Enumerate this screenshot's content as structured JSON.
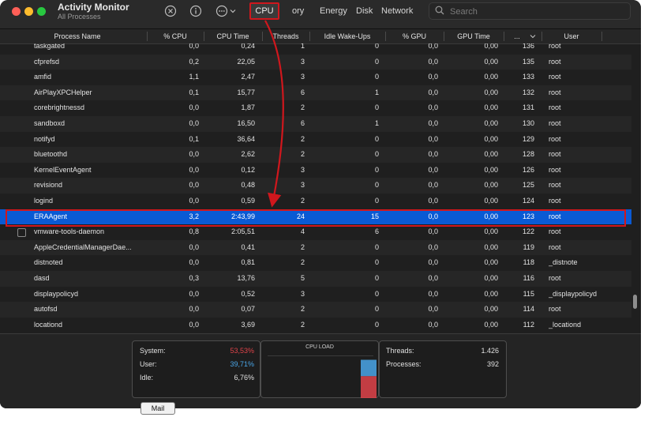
{
  "app": {
    "title": "Activity Monitor",
    "subtitle": "All Processes"
  },
  "toolbar": {
    "icons": [
      "stop-process-icon",
      "info-icon",
      "more-actions-icon",
      "chevron-down-icon"
    ],
    "tabs": [
      "CPU",
      "ory",
      "Energy",
      "Disk",
      "Network"
    ],
    "search_placeholder": "Search"
  },
  "columns": [
    "Process Name",
    "% CPU",
    "CPU Time",
    "Threads",
    "Idle Wake-Ups",
    "% GPU",
    "GPU Time",
    "...",
    "User"
  ],
  "rows": [
    {
      "name": "taskgated",
      "cpu": "0,0",
      "time": "0,24",
      "threads": "1",
      "wake": "0",
      "gpu": "0,0",
      "gtime": "0,00",
      "pid": "136",
      "user": "root"
    },
    {
      "name": "cfprefsd",
      "cpu": "0,2",
      "time": "22,05",
      "threads": "3",
      "wake": "0",
      "gpu": "0,0",
      "gtime": "0,00",
      "pid": "135",
      "user": "root"
    },
    {
      "name": "amfid",
      "cpu": "1,1",
      "time": "2,47",
      "threads": "3",
      "wake": "0",
      "gpu": "0,0",
      "gtime": "0,00",
      "pid": "133",
      "user": "root"
    },
    {
      "name": "AirPlayXPCHelper",
      "cpu": "0,1",
      "time": "15,77",
      "threads": "6",
      "wake": "1",
      "gpu": "0,0",
      "gtime": "0,00",
      "pid": "132",
      "user": "root"
    },
    {
      "name": "corebrightnessd",
      "cpu": "0,0",
      "time": "1,87",
      "threads": "2",
      "wake": "0",
      "gpu": "0,0",
      "gtime": "0,00",
      "pid": "131",
      "user": "root"
    },
    {
      "name": "sandboxd",
      "cpu": "0,0",
      "time": "16,50",
      "threads": "6",
      "wake": "1",
      "gpu": "0,0",
      "gtime": "0,00",
      "pid": "130",
      "user": "root"
    },
    {
      "name": "notifyd",
      "cpu": "0,1",
      "time": "36,64",
      "threads": "2",
      "wake": "0",
      "gpu": "0,0",
      "gtime": "0,00",
      "pid": "129",
      "user": "root"
    },
    {
      "name": "bluetoothd",
      "cpu": "0,0",
      "time": "2,62",
      "threads": "2",
      "wake": "0",
      "gpu": "0,0",
      "gtime": "0,00",
      "pid": "128",
      "user": "root"
    },
    {
      "name": "KernelEventAgent",
      "cpu": "0,0",
      "time": "0,12",
      "threads": "3",
      "wake": "0",
      "gpu": "0,0",
      "gtime": "0,00",
      "pid": "126",
      "user": "root"
    },
    {
      "name": "revisiond",
      "cpu": "0,0",
      "time": "0,48",
      "threads": "3",
      "wake": "0",
      "gpu": "0,0",
      "gtime": "0,00",
      "pid": "125",
      "user": "root"
    },
    {
      "name": "logind",
      "cpu": "0,0",
      "time": "0,59",
      "threads": "2",
      "wake": "0",
      "gpu": "0,0",
      "gtime": "0,00",
      "pid": "124",
      "user": "root"
    },
    {
      "name": "ERAAgent",
      "cpu": "3,2",
      "time": "2:43,99",
      "threads": "24",
      "wake": "15",
      "gpu": "0,0",
      "gtime": "0,00",
      "pid": "123",
      "user": "root",
      "selected": true
    },
    {
      "name": "vmware-tools-daemon",
      "cpu": "0,8",
      "time": "2:05,51",
      "threads": "4",
      "wake": "6",
      "gpu": "0,0",
      "gtime": "0,00",
      "pid": "122",
      "user": "root",
      "checkbox": true
    },
    {
      "name": "AppleCredentialManagerDae...",
      "cpu": "0,0",
      "time": "0,41",
      "threads": "2",
      "wake": "0",
      "gpu": "0,0",
      "gtime": "0,00",
      "pid": "119",
      "user": "root"
    },
    {
      "name": "distnoted",
      "cpu": "0,0",
      "time": "0,81",
      "threads": "2",
      "wake": "0",
      "gpu": "0,0",
      "gtime": "0,00",
      "pid": "118",
      "user": "_distnote"
    },
    {
      "name": "dasd",
      "cpu": "0,3",
      "time": "13,76",
      "threads": "5",
      "wake": "0",
      "gpu": "0,0",
      "gtime": "0,00",
      "pid": "116",
      "user": "root"
    },
    {
      "name": "displaypolicyd",
      "cpu": "0,0",
      "time": "0,52",
      "threads": "3",
      "wake": "0",
      "gpu": "0,0",
      "gtime": "0,00",
      "pid": "115",
      "user": "_displaypolicyd"
    },
    {
      "name": "autofsd",
      "cpu": "0,0",
      "time": "0,07",
      "threads": "2",
      "wake": "0",
      "gpu": "0,0",
      "gtime": "0,00",
      "pid": "114",
      "user": "root"
    },
    {
      "name": "locationd",
      "cpu": "0,0",
      "time": "3,69",
      "threads": "2",
      "wake": "0",
      "gpu": "0,0",
      "gtime": "0,00",
      "pid": "112",
      "user": "_locationd"
    }
  ],
  "footer": {
    "system_label": "System:",
    "system_value": "53,53%",
    "user_label": "User:",
    "user_value": "39,71%",
    "idle_label": "Idle:",
    "idle_value": "6,76%",
    "cpu_load_title": "CPU LOAD",
    "threads_label": "Threads:",
    "threads_value": "1.426",
    "processes_label": "Processes:",
    "processes_value": "392",
    "system_pct": 53.53,
    "user_pct": 39.71,
    "colors": {
      "system": "#e0434a",
      "user": "#4aa6e8"
    }
  },
  "mail_button": "Mail"
}
